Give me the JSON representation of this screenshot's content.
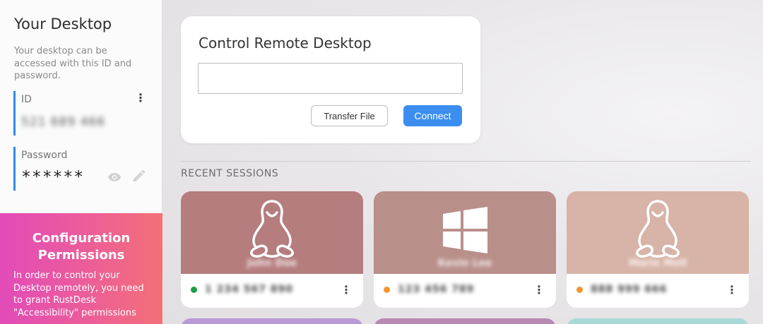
{
  "sidebar": {
    "title": "Your Desktop",
    "description": "Your desktop can be accessed with this ID and password.",
    "id_label": "ID",
    "id_value": "521 689 466",
    "password_label": "Password",
    "password_value": "******",
    "config_title": "Configuration Permissions",
    "config_text": "In order to control your Desktop remotely, you need to grant RustDesk \"Accessibility\" permissions"
  },
  "control": {
    "title": "Control Remote Desktop",
    "input_value": "",
    "transfer_label": "Transfer File",
    "connect_label": "Connect"
  },
  "recent": {
    "heading": "RECENT SESSIONS",
    "sessions": [
      {
        "name": "John Doe",
        "id": "1 234 567 890",
        "os": "linux-icon",
        "status": "online",
        "status_color": "#1e9e4a",
        "color": "#b57d7e"
      },
      {
        "name": "Kevin Lee",
        "id": "123 456 789",
        "os": "windows-icon",
        "status": "away",
        "status_color": "#f0962e",
        "color": "#b98f8a"
      },
      {
        "name": "Marie Moll",
        "id": "888 999 666",
        "os": "linux-icon",
        "status": "away",
        "status_color": "#f0962e",
        "color": "#d7b4a7"
      }
    ]
  }
}
